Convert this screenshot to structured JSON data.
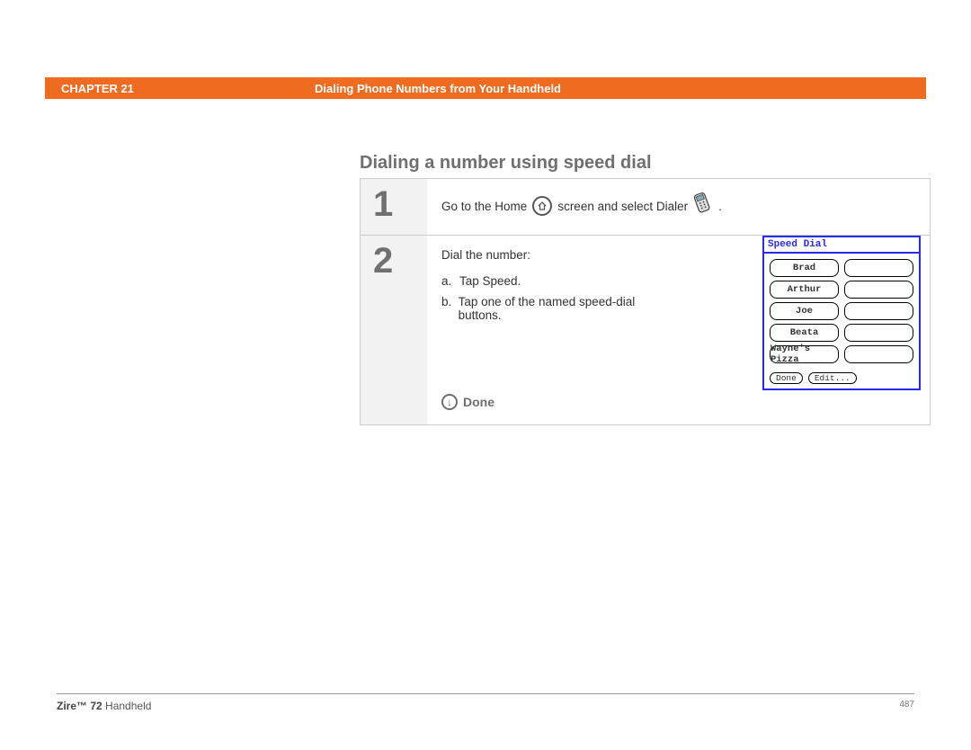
{
  "header": {
    "chapter_label": "CHAPTER 21",
    "chapter_title": "Dialing Phone Numbers from Your Handheld"
  },
  "section_title": "Dialing a number using speed dial",
  "steps": {
    "s1": {
      "num": "1",
      "text_a": "Go to the Home",
      "text_b": "screen and select Dialer",
      "text_c": "."
    },
    "s2": {
      "num": "2",
      "intro": "Dial the number:",
      "a_label": "a.",
      "a_text": "Tap Speed.",
      "b_label": "b.",
      "b_text": "Tap one of the named speed-dial buttons.",
      "done_label": "Done"
    }
  },
  "speeddial": {
    "title": "Speed Dial",
    "entries": [
      "Brad",
      "Arthur",
      "Joe",
      "Beata",
      "Wayne's Pizza"
    ],
    "done": "Done",
    "edit": "Edit..."
  },
  "footer": {
    "brand_bold": "Zire™ 72",
    "brand_rest": " Handheld",
    "page": "487"
  }
}
